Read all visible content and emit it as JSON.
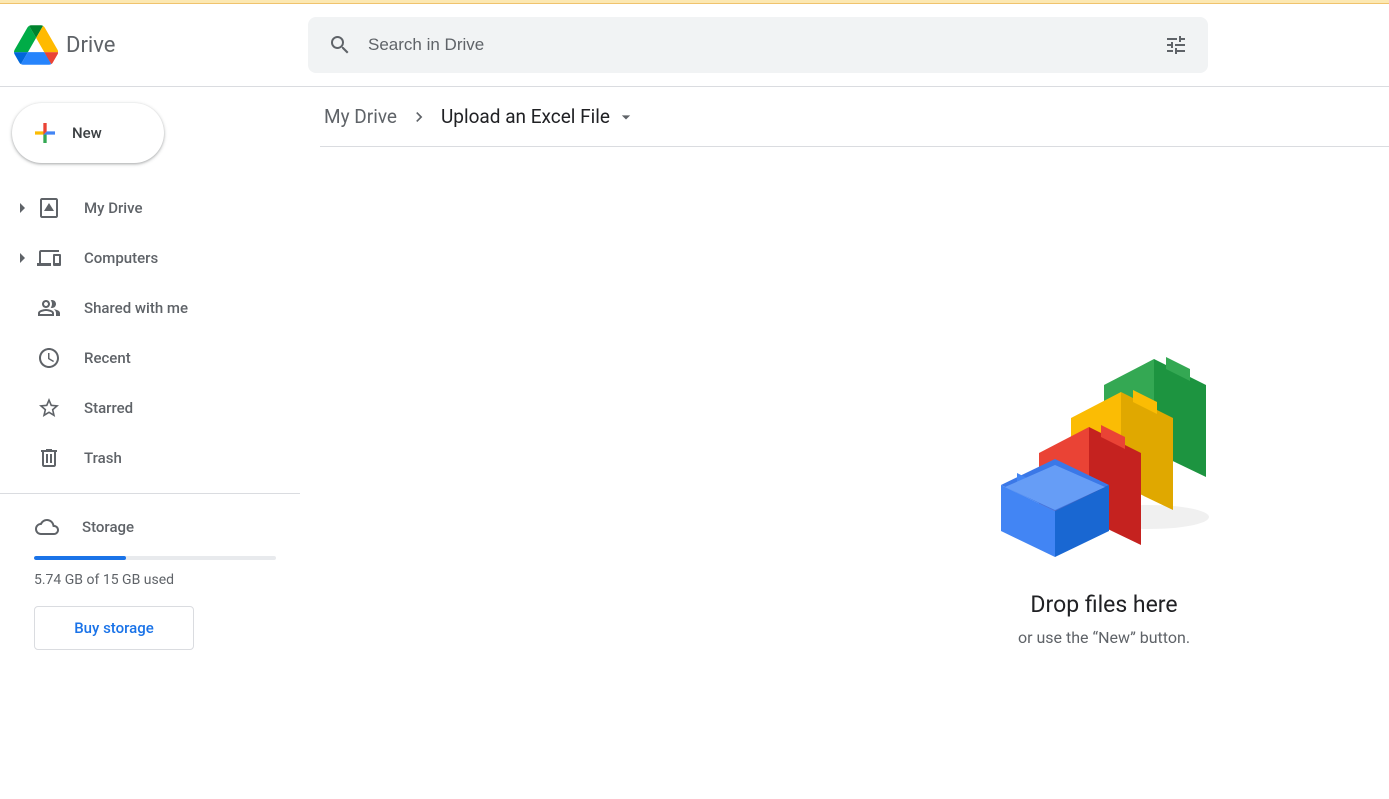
{
  "app": {
    "name": "Drive"
  },
  "search": {
    "placeholder": "Search in Drive"
  },
  "newButton": {
    "label": "New"
  },
  "sidebar": {
    "items": [
      {
        "label": "My Drive",
        "expandable": true
      },
      {
        "label": "Computers",
        "expandable": true
      },
      {
        "label": "Shared with me",
        "expandable": false
      },
      {
        "label": "Recent",
        "expandable": false
      },
      {
        "label": "Starred",
        "expandable": false
      },
      {
        "label": "Trash",
        "expandable": false
      }
    ]
  },
  "storage": {
    "label": "Storage",
    "percent": 38,
    "text": "5.74 GB of 15 GB used",
    "buy": "Buy storage"
  },
  "breadcrumb": {
    "root": "My Drive",
    "current": "Upload an Excel File"
  },
  "empty": {
    "title": "Drop files here",
    "subtitle": "or use the “New” button."
  },
  "colors": {
    "blue": "#4285F4",
    "red": "#EA4335",
    "yellow": "#FBBC04",
    "green": "#34A853"
  }
}
